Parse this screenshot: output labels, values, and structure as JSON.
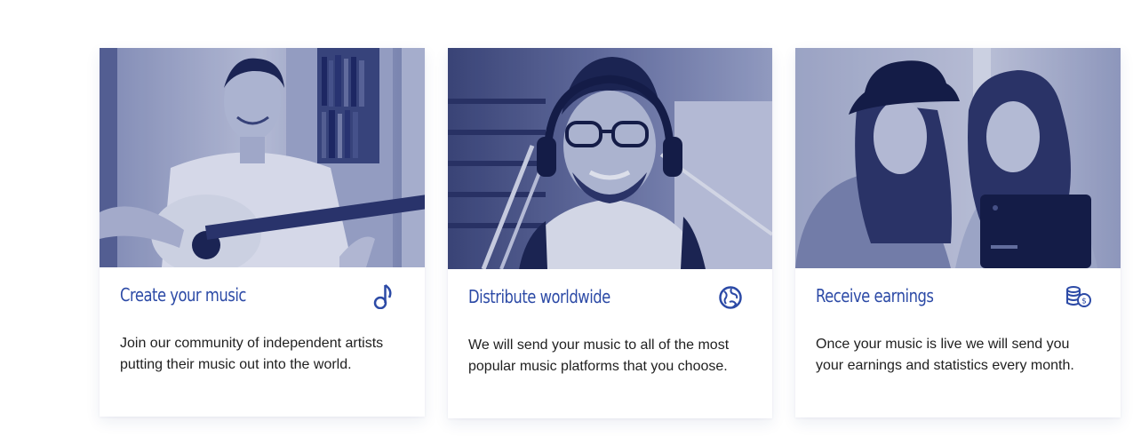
{
  "colors": {
    "accent": "#2c4aa6",
    "photo_tint": "#1e2f78",
    "text": "#1f1f1f"
  },
  "cards": [
    {
      "title": "Create your music",
      "icon": "music-note-icon",
      "description": "Join our community of independent artists putting their music out into the world."
    },
    {
      "title": "Distribute worldwide",
      "icon": "globe-icon",
      "description": "We will send your music to all of the most popular music platforms that you choose."
    },
    {
      "title": "Receive earnings",
      "icon": "coins-icon",
      "description": "Once your music is live we will send you your earnings and statistics every month."
    }
  ]
}
